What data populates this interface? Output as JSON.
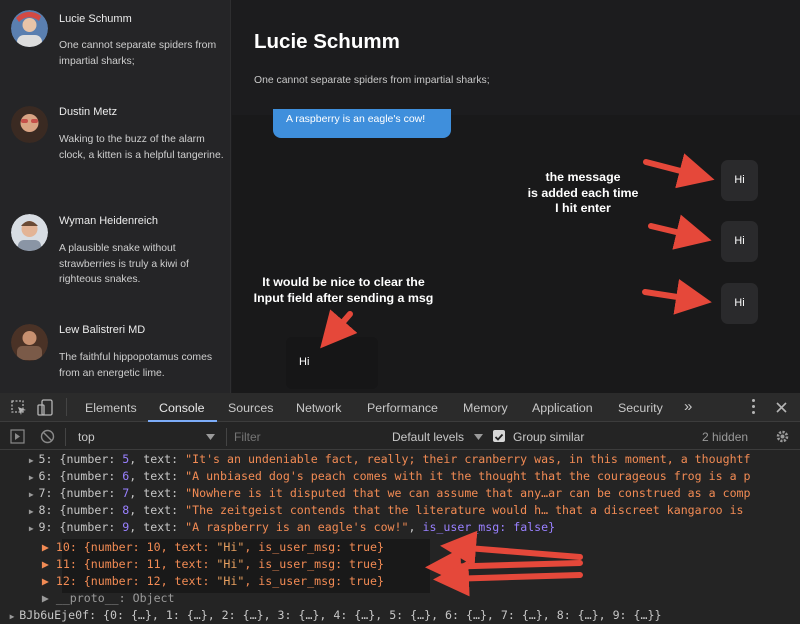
{
  "sidebar": {
    "contacts": [
      {
        "name": "Lucie Schumm",
        "preview": "One cannot separate spiders from impartial sharks;",
        "avatar_color": "#5a7fb0"
      },
      {
        "name": "Dustin Metz",
        "preview": "Waking to the buzz of the alarm clock, a kitten is a helpful tangerine.",
        "avatar_color": "#c6504a"
      },
      {
        "name": "Wyman Heidenreich",
        "preview": "A plausible snake without strawberries is truly a kiwi of righteous snakes.",
        "avatar_color": "#8a95a5"
      },
      {
        "name": "Lew Balistreri MD",
        "preview": "The faithful hippopotamus comes from an energetic lime.",
        "avatar_color": "#6a4a3a"
      }
    ]
  },
  "chat": {
    "title": "Lucie Schumm",
    "subtitle": "One cannot separate spiders from impartial sharks;",
    "received_message": "A raspberry is an eagle's cow!",
    "sent_messages": [
      "Hi",
      "Hi",
      "Hi"
    ],
    "composer_value": "Hi"
  },
  "annotations": {
    "message_note": "the message\nis added each time\nI hit enter",
    "input_note": "It would be nice to clear the\nInput field after sending a msg",
    "arrow_color": "#e5483a"
  },
  "devtools": {
    "tabs": [
      "Elements",
      "Console",
      "Sources",
      "Network",
      "Performance",
      "Memory",
      "Application",
      "Security"
    ],
    "active_tab": "Console",
    "more_tabs": "»",
    "context": "top",
    "filter_placeholder": "Filter",
    "levels": "Default levels",
    "group_similar": "Group similar",
    "hidden_count": "2 hidden",
    "lines": [
      {
        "idx": "5",
        "number": "5",
        "text": "\"It's an undeniable fact, really; their cranberry was, in this moment, a thoughtf"
      },
      {
        "idx": "6",
        "number": "6",
        "text": "\"A unbiased dog's peach comes with it the thought that the courageous frog is a p"
      },
      {
        "idx": "7",
        "number": "7",
        "text": "\"Nowhere is it disputed that we can assume that any…ar can be construed as a comp"
      },
      {
        "idx": "8",
        "number": "8",
        "text": "\"The zeitgeist contends that the literature would h… that a discreet kangaroo is"
      },
      {
        "idx": "9",
        "number": "9",
        "text": "\"A raspberry is an eagle's cow!\"",
        "flag": "is_user_msg: false}"
      }
    ],
    "user_lines": [
      {
        "idx": "10",
        "number": "10",
        "text": "\"Hi\"",
        "flag": "is_user_msg: true}"
      },
      {
        "idx": "11",
        "number": "11",
        "text": "\"Hi\"",
        "flag": "is_user_msg: true}"
      },
      {
        "idx": "12",
        "number": "12",
        "text": "\"Hi\"",
        "flag": "is_user_msg: true}"
      }
    ],
    "proto_line": "__proto__: Object",
    "last_line": "BJb6uEje0f: {0: {…}, 1: {…}, 2: {…}, 3: {…}, 4: {…}, 5: {…}, 6: {…}, 7: {…}, 8: {…}, 9: {…}}"
  }
}
